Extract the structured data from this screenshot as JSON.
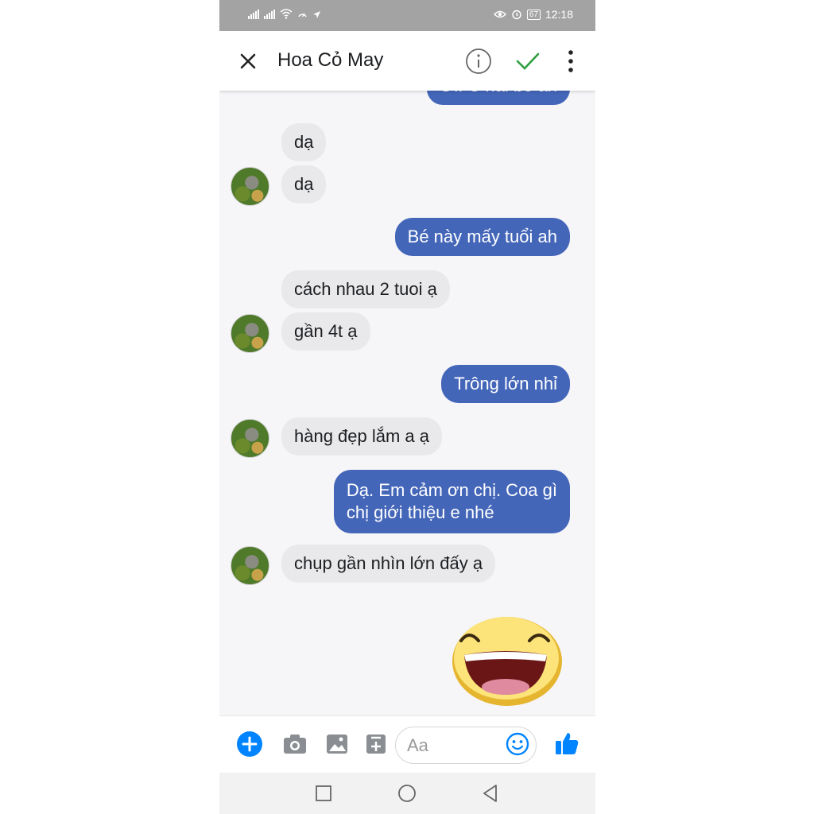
{
  "status_bar": {
    "battery": "67",
    "time": "12:18"
  },
  "header": {
    "contact_name": "Hoa Cỏ May"
  },
  "messages": [
    {
      "side": "out",
      "text": "Ơi. C hai bé ah"
    },
    {
      "side": "in",
      "text": "dạ"
    },
    {
      "side": "in",
      "text": "dạ"
    },
    {
      "side": "out",
      "text": "Bé này mấy tuổi ah"
    },
    {
      "side": "in",
      "text": "cách nhau 2 tuoi ạ"
    },
    {
      "side": "in",
      "text": "gần 4t ạ"
    },
    {
      "side": "out",
      "text": "Trông lớn nhỉ"
    },
    {
      "side": "in",
      "text": "hàng đẹp lắm a ạ"
    },
    {
      "side": "out",
      "lines": [
        "Dạ. Em cảm ơn chị. Coa gì",
        "chị giới thiệu e nhé"
      ]
    },
    {
      "side": "in",
      "text": "chụp gần nhìn lớn đấy ạ"
    }
  ],
  "composer": {
    "placeholder": "Aa"
  },
  "icons": {
    "close": "close-icon",
    "info": "info-icon",
    "check": "check-icon",
    "more": "more-vertical-icon",
    "plus": "plus-circle-icon",
    "camera": "camera-icon",
    "image": "image-icon",
    "sticker": "sticker-icon",
    "smile": "smile-icon",
    "like": "thumbs-up-icon",
    "nav_recent": "square-icon",
    "nav_home": "circle-icon",
    "nav_back": "triangle-back-icon"
  },
  "colors": {
    "accent": "#0084ff",
    "outgoing_bubble": "#4466b9",
    "incoming_bubble": "#e9e9eb",
    "check": "#2e9e3e"
  }
}
